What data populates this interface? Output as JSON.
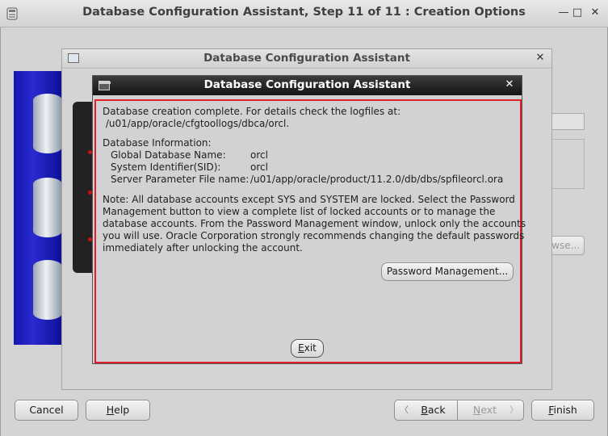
{
  "main_window": {
    "title": "Database Configuration Assistant, Step 11 of 11 : Creation Options",
    "minimize_glyph": "—",
    "maximize_glyph": "□",
    "close_glyph": "✕",
    "icon": "app-icon"
  },
  "background_dialog": {
    "title": "Database Configuration Assistant",
    "close_glyph": "✕",
    "browse_label": "Browse..."
  },
  "completion_dialog": {
    "title": "Database Configuration Assistant",
    "close_glyph": "✕",
    "intro_line1": "Database creation complete. For details check the logfiles at:",
    "intro_line2": " /u01/app/oracle/cfgtoollogs/dbca/orcl.",
    "info_heading": "Database Information:",
    "info_rows": [
      {
        "label": "Global Database Name:",
        "value": "orcl"
      },
      {
        "label": "System Identifier(SID):",
        "value": "orcl"
      },
      {
        "label": "Server Parameter File name:",
        "value": "/u01/app/oracle/product/11.2.0/db/dbs/spfileorcl.ora"
      }
    ],
    "note_lines": [
      "Note: All database accounts except SYS and SYSTEM are locked. Select the Password",
      "Management button to view a complete list of locked accounts or to manage the",
      "database accounts. From the Password Management window, unlock only the accounts",
      "you will use. Oracle Corporation strongly recommends changing the default passwords",
      "immediately after unlocking the account."
    ],
    "password_button_label": "Password Management...",
    "exit_button_label": "Exit"
  },
  "footer": {
    "cancel_label": "Cancel",
    "help_label": "Help",
    "back_label": "Back",
    "next_label": "Next",
    "finish_label": "Finish",
    "back_arrow": "〈",
    "next_arrow": "〉"
  },
  "colors": {
    "accent_red": "#e01e2e",
    "wizard_blue": "#1a1ab8",
    "title_dark": "#141414"
  }
}
